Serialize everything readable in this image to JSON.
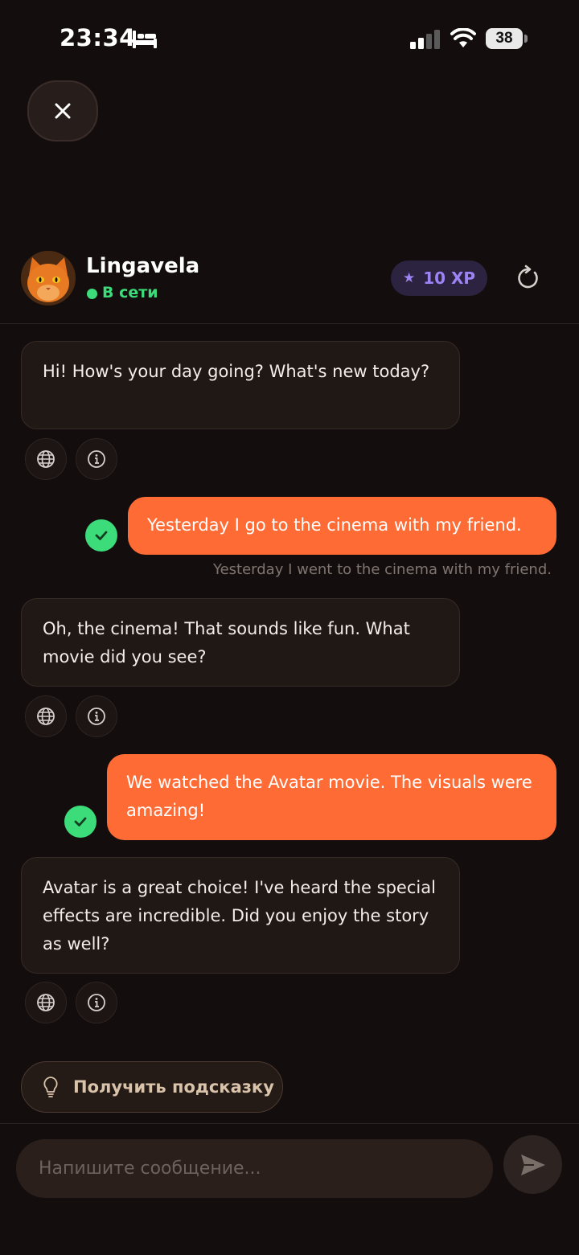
{
  "status_bar": {
    "time": "23:34",
    "battery": "38"
  },
  "header": {
    "bot_name": "Lingavela",
    "status": "В сети",
    "xp": "10 XP"
  },
  "messages": [
    {
      "role": "bot",
      "text": "Hi! How's your day going? What's new today?"
    },
    {
      "role": "user",
      "text": "Yesterday I go to the cinema with my friend.",
      "correction": "Yesterday I went to the cinema with my friend."
    },
    {
      "role": "bot",
      "text": "Oh, the cinema! That sounds like fun. What movie did you see?"
    },
    {
      "role": "user",
      "text": "We watched the Avatar movie. The visuals were amazing!"
    },
    {
      "role": "bot",
      "text": "Avatar is a great choice! I've heard the special effects are incredible. Did you enjoy the story as well?"
    }
  ],
  "hint_button": "Получить подсказку",
  "input": {
    "placeholder": "Напишите сообщение...",
    "value": ""
  },
  "colors": {
    "background": "#130e0d",
    "accent": "#ff6b35",
    "online": "#3ddc7a",
    "xp": "#9d84f5"
  }
}
